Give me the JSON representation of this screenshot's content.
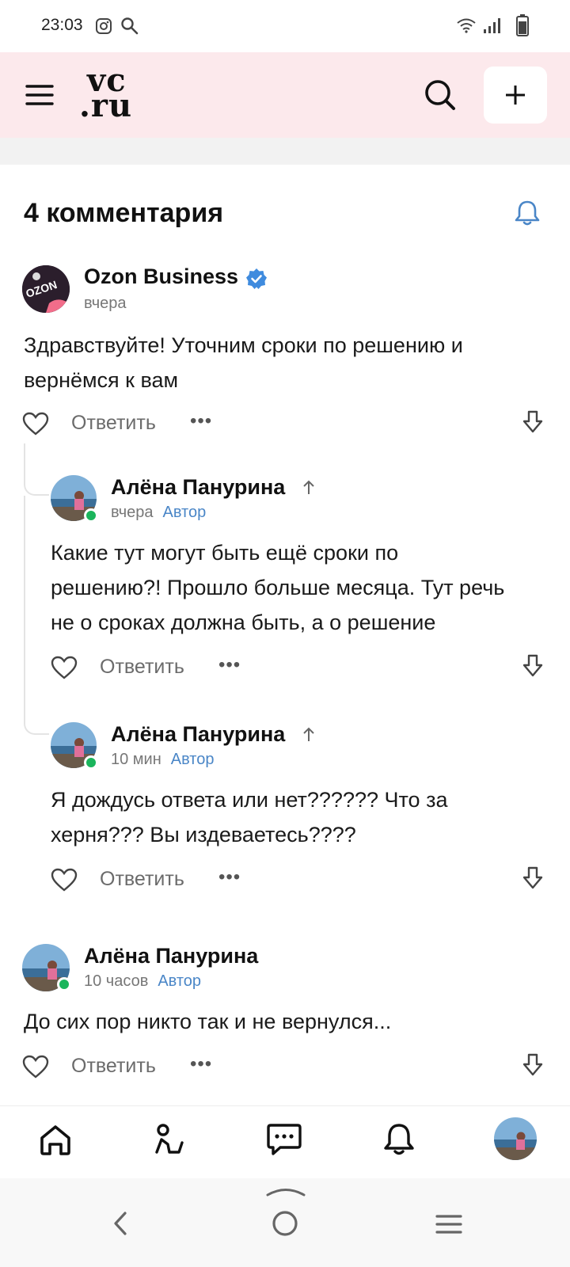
{
  "status_bar": {
    "time": "23:03"
  },
  "app_bar": {
    "logo_line1": "vc",
    "logo_line2": ".ru"
  },
  "comments_header": {
    "title": "4 комментария"
  },
  "actions": {
    "reply_label": "Ответить",
    "more_label": "•••"
  },
  "comments": [
    {
      "author": "Ozon Business",
      "verified": true,
      "time": "вчера",
      "author_tag": "",
      "avatar_text": "OZON",
      "text_lines": [
        "Здравствуйте! Уточним сроки по решению и",
        "вернёмся к вам"
      ]
    },
    {
      "author": "Алёна Панурина",
      "time": "вчера",
      "author_tag": "Автор",
      "text_lines": [
        "Какие тут могут быть ещё сроки по",
        "решению?! Прошло больше месяца. Тут речь",
        "не о сроках должна быть, а о решение"
      ]
    },
    {
      "author": "Алёна Панурина",
      "time": "10 мин",
      "author_tag": "Автор",
      "text_lines": [
        "Я дождусь ответа или нет?????? Что за",
        "херня??? Вы издеваетесь????"
      ]
    },
    {
      "author": "Алёна Панурина",
      "time": "10 часов",
      "author_tag": "Автор",
      "text_lines": [
        "До сих пор никто так и не вернулся..."
      ]
    }
  ],
  "bottom_nav": [
    "home-icon",
    "feed-icon",
    "messages-icon",
    "notifications-icon",
    "profile-avatar"
  ],
  "colors": {
    "app_bar_bg": "#fce9ec",
    "accent_blue": "#4a86c7",
    "online_green": "#1bb55c"
  }
}
